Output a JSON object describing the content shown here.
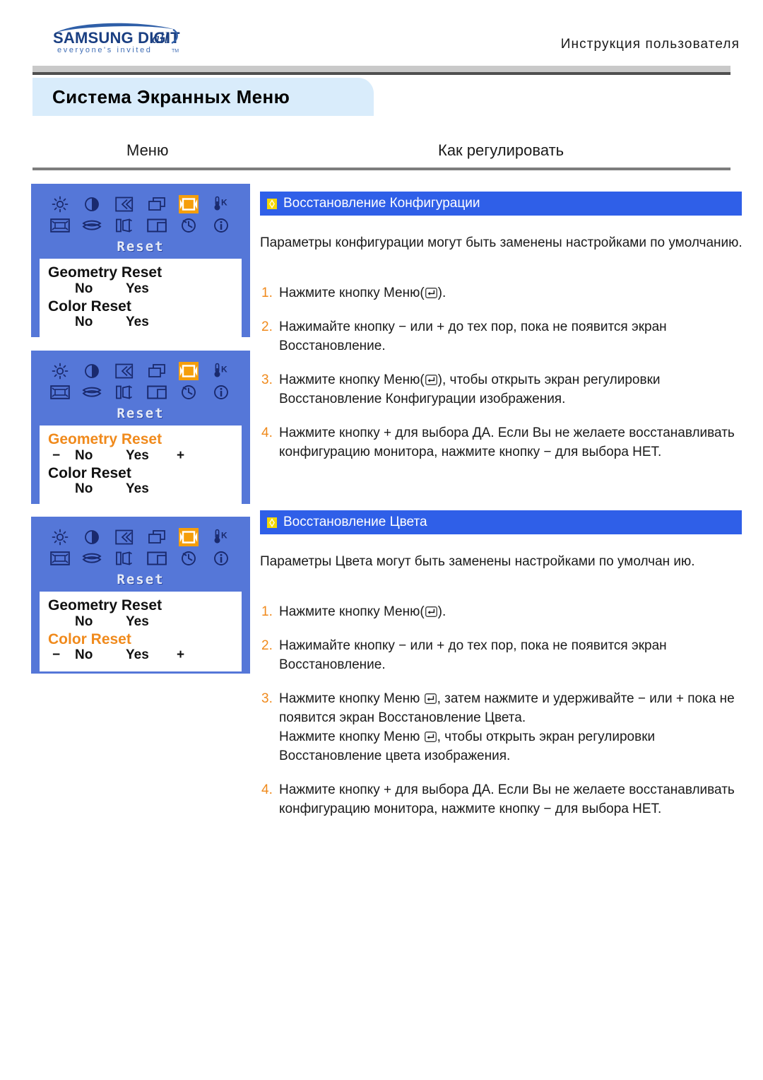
{
  "header": {
    "logo_main": "SAMSUNG DIGITall",
    "logo_tagline": "everyone's invited™",
    "manual_title": "Инструкция  пользователя"
  },
  "page_title": "Система  Экранных  Меню",
  "columns": {
    "menu": "Меню",
    "how_to_adjust": "Как регулировать"
  },
  "colors": {
    "osd_background": "#5577d8",
    "osd_highlight": "#f08a1c",
    "osd_selected_icon": "#f59e0b",
    "section_bar": "#2f5fe8",
    "step_number": "#f08a1c",
    "title_tab": "#d9ecfb"
  },
  "osd_icons": [
    "brightness-icon",
    "contrast-icon",
    "h-position-icon",
    "v-position-icon",
    "reset-icon",
    "color-temperature-icon",
    "image-size-icon",
    "pincushion-icon",
    "parallelogram-icon",
    "trapezoid-icon",
    "clock-icon",
    "information-icon"
  ],
  "osd_selected_index": 4,
  "osd_screens": [
    {
      "title": "Reset",
      "rows": [
        {
          "label": "Geometry Reset",
          "highlighted": false,
          "no": "No",
          "yes": "Yes",
          "show_minus": false,
          "show_plus": false,
          "minus": "−",
          "plus": "+"
        },
        {
          "label": "Color Reset",
          "highlighted": false,
          "no": "No",
          "yes": "Yes",
          "show_minus": false,
          "show_plus": false,
          "minus": "−",
          "plus": "+"
        }
      ]
    },
    {
      "title": "Reset",
      "rows": [
        {
          "label": "Geometry Reset",
          "highlighted": true,
          "no": "No",
          "yes": "Yes",
          "show_minus": true,
          "show_plus": true,
          "minus": "−",
          "plus": "+"
        },
        {
          "label": "Color Reset",
          "highlighted": false,
          "no": "No",
          "yes": "Yes",
          "show_minus": false,
          "show_plus": false,
          "minus": "−",
          "plus": "+"
        }
      ]
    },
    {
      "title": "Reset",
      "rows": [
        {
          "label": "Geometry Reset",
          "highlighted": false,
          "no": "No",
          "yes": "Yes",
          "show_minus": false,
          "show_plus": false,
          "minus": "−",
          "plus": "+"
        },
        {
          "label": "Color Reset",
          "highlighted": true,
          "no": "No",
          "yes": "Yes",
          "show_minus": true,
          "show_plus": true,
          "minus": "−",
          "plus": "+"
        }
      ]
    }
  ],
  "sections": [
    {
      "bullet": "diamond-bullet-icon",
      "title": "Восстановление Конфигурации",
      "intro": "Параметры конфигурации могут быть заменены настройками по умолчанию.",
      "steps": [
        {
          "num": "1.",
          "pre": "Нажмите кнопку Меню(",
          "key": "enter-key-icon",
          "post": ")."
        },
        {
          "num": "2.",
          "pre": "Нажимайте кнопку − или + до тех пор, пока не появится экран Восстановление.",
          "key": null,
          "post": ""
        },
        {
          "num": "3.",
          "pre": "Нажмите кнопку Меню(",
          "key": "enter-key-icon",
          "post": "), чтобы открыть экран регулировки Восстановление Конфигурации изображения."
        },
        {
          "num": "4.",
          "pre": "Нажмите кнопку + для выбора ДА. Если Вы не желаете восстанавливать конфигурацию монитора, нажмите кнопку − для выбора НЕТ.",
          "key": null,
          "post": ""
        }
      ]
    },
    {
      "bullet": "diamond-bullet-icon",
      "title": "Восстановление Цвета",
      "intro": "Параметры Цвета могут быть заменены настройками по умолчан ию.",
      "steps": [
        {
          "num": "1.",
          "pre": "Нажмите кнопку Меню(",
          "key": "enter-key-icon",
          "post": ")."
        },
        {
          "num": "2.",
          "pre": "Нажимайте кнопку − или + до тех пор, пока не появится экран Восстановление.",
          "key": null,
          "post": ""
        },
        {
          "num": "3.",
          "pre": "Нажмите кнопку Меню ",
          "key": "enter-key-icon",
          "post": ", затем нажмите и удерживайте − или + пока не появится экран Восстановление Цвета.",
          "extra_pre": "Нажмите кнопку Меню ",
          "extra_key": "enter-key-icon",
          "extra_post": ", чтобы открыть экран регулировки Восстановление цвета изображения."
        },
        {
          "num": "4.",
          "pre": "Нажмите кнопку + для выбора ДА. Если Вы не желаете восстанавливать конфигурацию монитора, нажмите кнопку − для выбора НЕТ.",
          "key": null,
          "post": ""
        }
      ]
    }
  ]
}
